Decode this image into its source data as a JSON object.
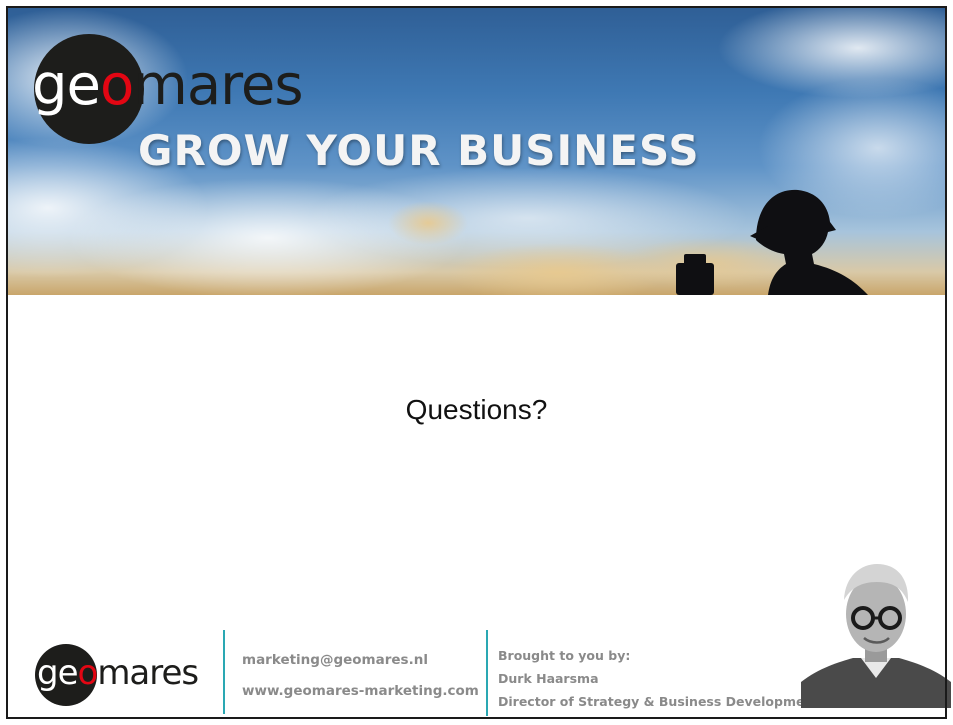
{
  "banner": {
    "logo_text": {
      "part1": "ge",
      "part2": "o",
      "part3": "mares"
    },
    "tagline": "GROW YOUR BUSINESS"
  },
  "main": {
    "question": "Questions?"
  },
  "footer": {
    "logo_text": {
      "part1": "ge",
      "part2": "o",
      "part3": "mares"
    },
    "email": "marketing@geomares.nl",
    "website": "www.geomares-marketing.com",
    "credits_label": "Brought to you by:",
    "presenter_name": "Durk Haarsma",
    "presenter_title": "Director of Strategy & Business Development"
  },
  "colors": {
    "brand_dark": "#1d1d1b",
    "brand_red": "#e30613",
    "divider_teal": "#2aa8b3",
    "footer_text_gray": "#8a8a8a"
  },
  "icons": {
    "surveyor": "surveyor-silhouette-icon",
    "portrait": "presenter-portrait-icon"
  }
}
